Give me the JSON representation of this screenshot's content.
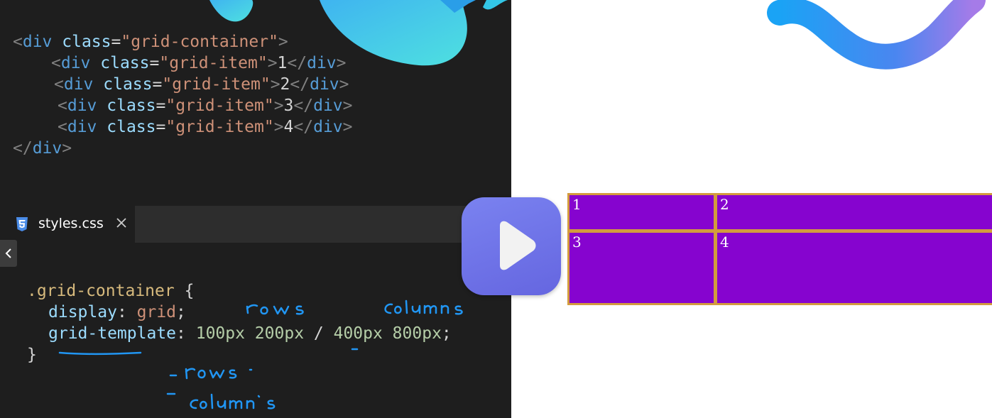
{
  "html_code": {
    "lines": [
      {
        "open": "<",
        "name": "div",
        "attr": " class",
        "eq": "=",
        "str": "\"grid-container\"",
        "close": ">",
        "text": "",
        "endopen": "",
        "endname": "",
        "endclose": ""
      },
      {
        "open": "<",
        "name": "div",
        "attr": " class",
        "eq": "=",
        "str": "\"grid-item\"",
        "close": ">",
        "text": "1",
        "endopen": "</",
        "endname": "div",
        "endclose": ">"
      },
      {
        "open": "<",
        "name": "div",
        "attr": " class",
        "eq": "=",
        "str": "\"grid-item\"",
        "close": ">",
        "text": "2",
        "endopen": "</",
        "endname": "div",
        "endclose": ">"
      },
      {
        "open": "<",
        "name": "div",
        "attr": " class",
        "eq": "=",
        "str": "\"grid-item\"",
        "close": ">",
        "text": "3",
        "endopen": "</",
        "endname": "div",
        "endclose": ">"
      },
      {
        "open": "<",
        "name": "div",
        "attr": " class",
        "eq": "=",
        "str": "\"grid-item\"",
        "close": ">",
        "text": "4",
        "endopen": "</",
        "endname": "div",
        "endclose": ">"
      }
    ],
    "closing": {
      "open": "</",
      "name": "div",
      "close": ">"
    }
  },
  "tab": {
    "label": "styles.css",
    "icon": "css3-icon",
    "close_icon": "close-icon"
  },
  "css_code": {
    "selector": ".grid-container",
    "open_brace": " {",
    "prop1": "display",
    "prop1_colon": ": ",
    "prop1_value": "grid",
    "prop1_semi": ";",
    "prop2": "grid-template",
    "prop2_colon": ": ",
    "prop2_value_a": "100px 200px",
    "prop2_slash": " / ",
    "prop2_value_b": "400px 800px",
    "prop2_semi": ";",
    "close_brace": "}"
  },
  "annotations": {
    "rows_label": "rows",
    "columns_label": "columns",
    "list_rows": "- rows .",
    "list_columns": "- columns"
  },
  "preview": {
    "items": [
      "1",
      "2",
      "3",
      "4"
    ],
    "colors": {
      "item_bg": "#8604cf",
      "gap_bg": "#d39b3e"
    }
  },
  "play_button": {
    "icon": "play-icon",
    "color": "#6b6fe8"
  },
  "colors": {
    "editor_bg": "#1e1e1e",
    "annotation_blue": "#2196f3"
  }
}
